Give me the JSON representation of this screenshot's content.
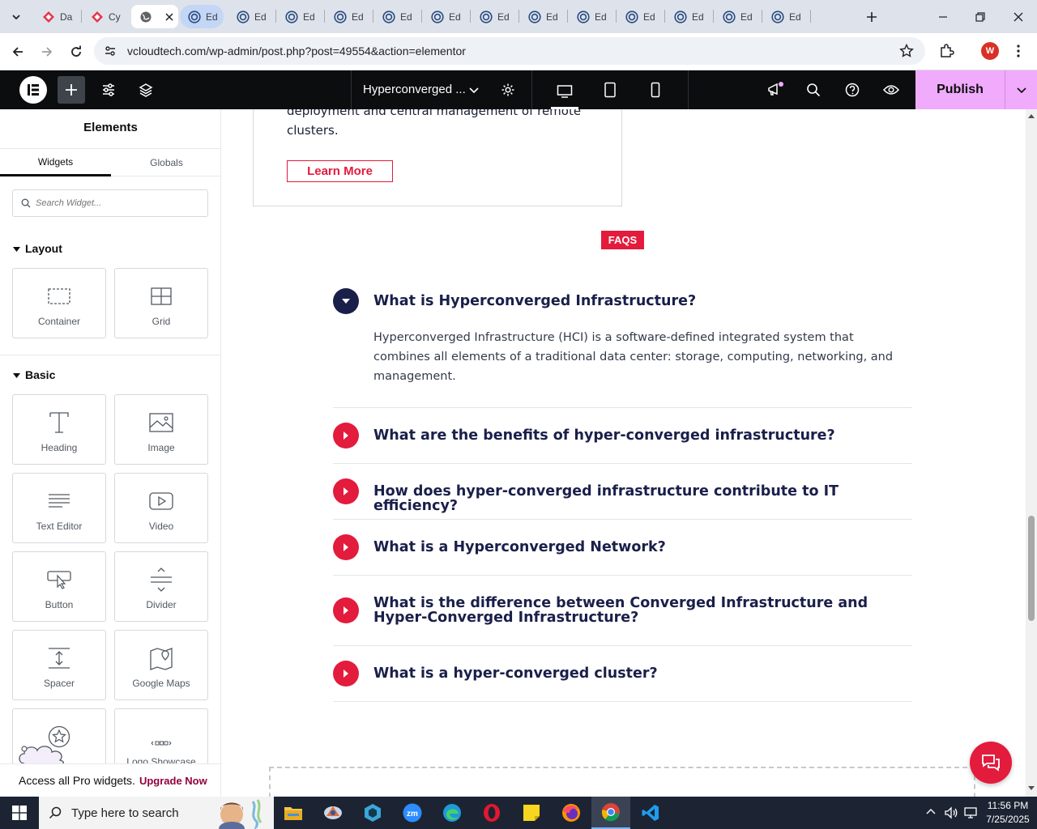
{
  "browser": {
    "tabs": [
      {
        "label": "Da",
        "icon": "diamond-red-icon"
      },
      {
        "label": "Cy",
        "icon": "diamond-red-icon"
      },
      {
        "label": "",
        "icon": "globe-icon",
        "active": true
      },
      {
        "label": "Ed",
        "icon": "wp-icon",
        "selected": true
      },
      {
        "label": "Ed",
        "icon": "wp-icon"
      },
      {
        "label": "Ed",
        "icon": "wp-icon"
      },
      {
        "label": "Ed",
        "icon": "wp-icon"
      },
      {
        "label": "Ed",
        "icon": "wp-icon"
      },
      {
        "label": "Ed",
        "icon": "wp-icon"
      },
      {
        "label": "Ed",
        "icon": "wp-icon"
      },
      {
        "label": "Ed",
        "icon": "wp-icon"
      },
      {
        "label": "Ed",
        "icon": "wp-icon"
      },
      {
        "label": "Ed",
        "icon": "wp-icon"
      },
      {
        "label": "Ed",
        "icon": "wp-icon"
      },
      {
        "label": "Ed",
        "icon": "wp-icon"
      },
      {
        "label": "Ed",
        "icon": "wp-icon"
      }
    ],
    "url": "vcloudtech.com/wp-admin/post.php?post=49554&action=elementor",
    "profile_initial": "W"
  },
  "elementor": {
    "doc_title": "Hyperconverged ...",
    "publish_label": "Publish"
  },
  "panel": {
    "title": "Elements",
    "tabs": [
      "Widgets",
      "Globals"
    ],
    "search_placeholder": "Search Widget...",
    "layout_label": "Layout",
    "basic_label": "Basic",
    "layout_widgets": [
      "Container",
      "Grid"
    ],
    "basic_widgets": [
      "Heading",
      "Image",
      "Text Editor",
      "Video",
      "Button",
      "Divider",
      "Spacer",
      "Google Maps",
      "",
      "Logo Showcase"
    ],
    "promo_text": "Access all Pro widgets.",
    "promo_link": "Upgrade Now"
  },
  "canvas": {
    "card_text": "deployment and central management of remote clusters.",
    "learn_more": "Learn More",
    "faq_badge": "FAQS",
    "faqs": [
      {
        "question": "What is Hyperconverged Infrastructure?",
        "answer": "Hyperconverged Infrastructure (HCI) is a software-defined integrated system that combines all elements of a traditional data center: storage, computing, networking, and management.",
        "open": true
      },
      {
        "question": "What are the benefits of hyper-converged infrastructure?",
        "open": false
      },
      {
        "question": "How does hyper-converged infrastructure contribute to IT efficiency?",
        "open": false
      },
      {
        "question": "What is a Hyperconverged Network?",
        "open": false
      },
      {
        "question": "What is the difference between Converged Infrastructure and Hyper-Converged Infrastructure?",
        "open": false
      },
      {
        "question": "What is a hyper-converged cluster?",
        "open": false
      }
    ]
  },
  "taskbar": {
    "search_placeholder": "Type here to search",
    "time": "11:56 PM",
    "date": "7/25/2025"
  },
  "colors": {
    "accent_red": "#e31b3c",
    "publish_pink": "#f0abfc",
    "faq_question": "#1a1f4a"
  }
}
